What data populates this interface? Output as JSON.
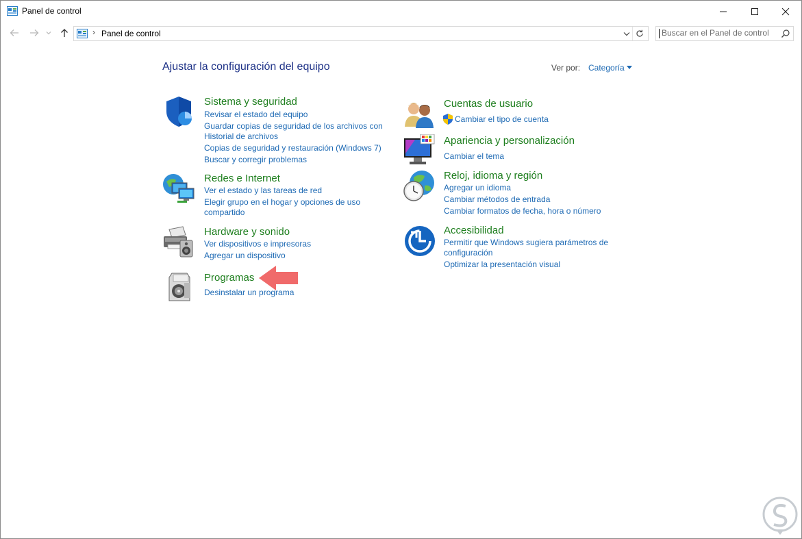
{
  "window": {
    "title": "Panel de control",
    "controls": {
      "minimize": "—",
      "maximize": "☐",
      "close": "✕"
    }
  },
  "nav": {
    "back_icon": "arrow-left-icon",
    "forward_icon": "arrow-right-icon",
    "recent_icon": "chevron-down-icon",
    "up_icon": "arrow-up-icon"
  },
  "address": {
    "separator": "›",
    "path": "Panel de control"
  },
  "search": {
    "placeholder": "Buscar en el Panel de control"
  },
  "main": {
    "heading": "Ajustar la configuración del equipo",
    "view_by_label": "Ver por:",
    "view_by_value": "Categoría"
  },
  "categories": {
    "system": {
      "title": "Sistema y seguridad",
      "links": [
        "Revisar el estado del equipo",
        "Guardar copias de seguridad de los archivos con",
        "Historial de archivos",
        "Copias de seguridad y restauración (Windows 7)",
        "Buscar y corregir problemas"
      ]
    },
    "network": {
      "title": "Redes e Internet",
      "links": [
        "Ver el estado y las tareas de red",
        "Elegir grupo en el hogar y opciones de uso",
        "compartido"
      ]
    },
    "hardware": {
      "title": "Hardware y sonido",
      "links": [
        "Ver dispositivos e impresoras",
        "Agregar un dispositivo"
      ]
    },
    "programs": {
      "title": "Programas",
      "links": [
        "Desinstalar un programa"
      ]
    },
    "accounts": {
      "title": "Cuentas de usuario",
      "links": [
        "Cambiar el tipo de cuenta"
      ]
    },
    "appearance": {
      "title": "Apariencia y personalización",
      "links": [
        "Cambiar el tema"
      ]
    },
    "clock": {
      "title": "Reloj, idioma y región",
      "links": [
        "Agregar un idioma",
        "Cambiar métodos de entrada",
        "Cambiar formatos de fecha, hora o número"
      ]
    },
    "accessibility": {
      "title": "Accesibilidad",
      "links": [
        "Permitir que Windows sugiera parámetros de",
        "configuración",
        "Optimizar la presentación visual"
      ]
    }
  },
  "colors": {
    "heading": "#1e3287",
    "category_title": "#1d7e1d",
    "link": "#1e6ab4",
    "annotation_arrow": "#f06a6a"
  }
}
